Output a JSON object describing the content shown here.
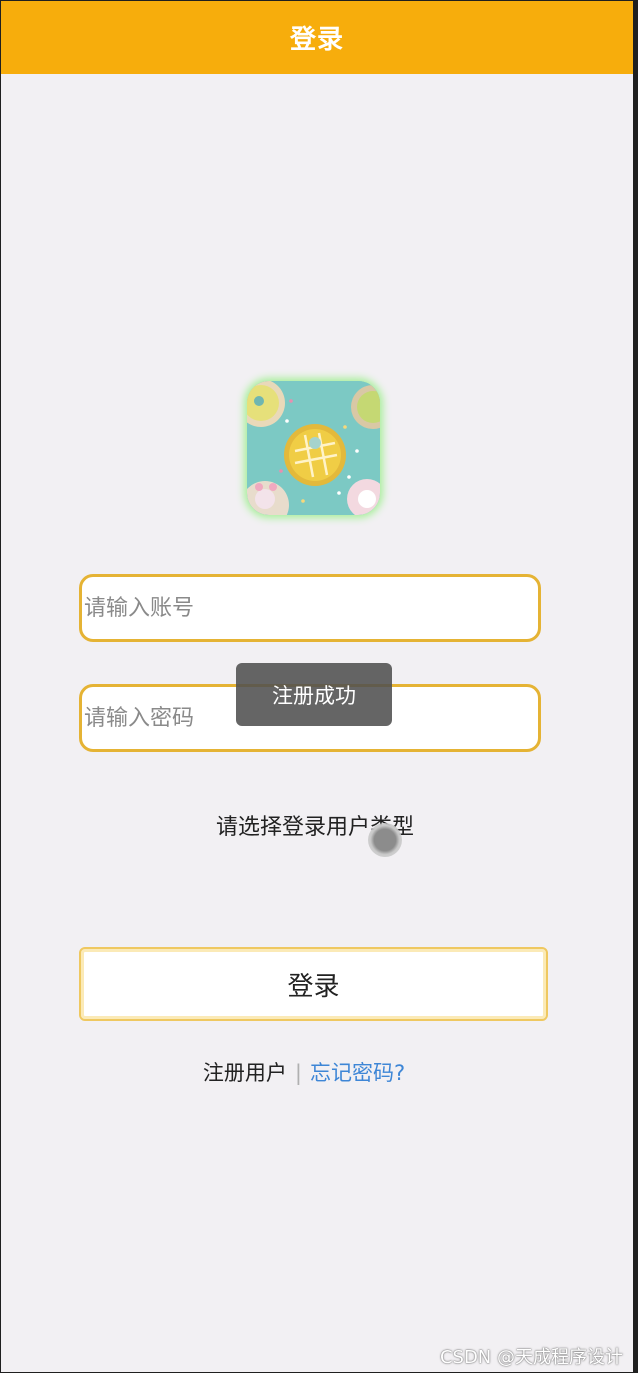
{
  "header": {
    "title": "登录"
  },
  "form": {
    "account_placeholder": "请输入账号",
    "password_placeholder": "请输入密码",
    "user_type_label": "请选择登录用户类型",
    "login_button": "登录"
  },
  "toast": {
    "message": "注册成功"
  },
  "links": {
    "register": "注册用户",
    "divider": "|",
    "forgot": "忘记密码?"
  },
  "watermark": "CSDN @天成程序设计",
  "colors": {
    "header_bg": "#f7ad0c",
    "input_border": "#e5b334",
    "link_blue": "#3e86d6",
    "page_bg": "#f2f0f3"
  }
}
